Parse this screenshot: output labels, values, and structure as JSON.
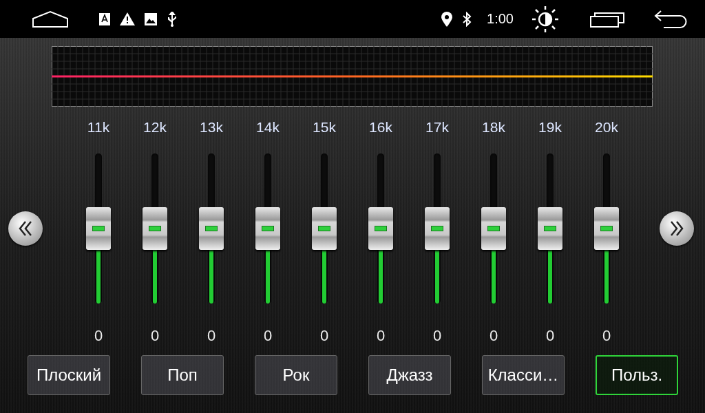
{
  "status_bar": {
    "time": "1:00"
  },
  "bands": [
    {
      "label": "11k",
      "level": 0.5,
      "value": "0"
    },
    {
      "label": "12k",
      "level": 0.5,
      "value": "0"
    },
    {
      "label": "13k",
      "level": 0.5,
      "value": "0"
    },
    {
      "label": "14k",
      "level": 0.5,
      "value": "0"
    },
    {
      "label": "15k",
      "level": 0.5,
      "value": "0"
    },
    {
      "label": "16k",
      "level": 0.5,
      "value": "0"
    },
    {
      "label": "17k",
      "level": 0.5,
      "value": "0"
    },
    {
      "label": "18k",
      "level": 0.5,
      "value": "0"
    },
    {
      "label": "19k",
      "level": 0.5,
      "value": "0"
    },
    {
      "label": "20k",
      "level": 0.5,
      "value": "0"
    }
  ],
  "presets": [
    {
      "label": "Плоский",
      "selected": false
    },
    {
      "label": "Поп",
      "selected": false
    },
    {
      "label": "Рок",
      "selected": false
    },
    {
      "label": "Джазз",
      "selected": false
    },
    {
      "label": "Класси…",
      "selected": false
    },
    {
      "label": "Польз.",
      "selected": true
    }
  ]
}
